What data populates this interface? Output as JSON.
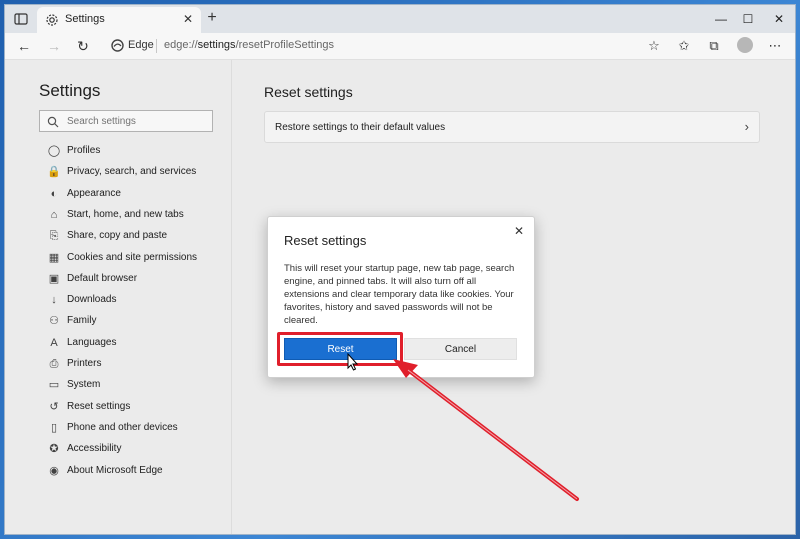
{
  "browser": {
    "tab_title": "Settings",
    "new_tab_glyph": "+",
    "close_tab_glyph": "✕",
    "edge_label": "Edge",
    "url_prefix": "edge://",
    "url_host": "settings",
    "url_path": "/resetProfileSettings",
    "window_controls": {
      "minimize": "—",
      "maximize": "☐",
      "close": "✕"
    },
    "icons": [
      "tab-actions-icon",
      "gear-icon",
      "back-icon",
      "forward-icon",
      "refresh-icon",
      "edge-logo-icon",
      "add-favorite-icon",
      "favorites-icon",
      "collections-icon",
      "profile-avatar",
      "more-icon"
    ]
  },
  "sidebar": {
    "title": "Settings",
    "search_placeholder": "Search settings",
    "items": [
      {
        "label": "Profiles",
        "icon": "profile-icon"
      },
      {
        "label": "Privacy, search, and services",
        "icon": "lock-icon"
      },
      {
        "label": "Appearance",
        "icon": "appearance-icon"
      },
      {
        "label": "Start, home, and new tabs",
        "icon": "home-icon"
      },
      {
        "label": "Share, copy and paste",
        "icon": "share-icon"
      },
      {
        "label": "Cookies and site permissions",
        "icon": "cookies-icon"
      },
      {
        "label": "Default browser",
        "icon": "browser-icon"
      },
      {
        "label": "Downloads",
        "icon": "download-icon"
      },
      {
        "label": "Family",
        "icon": "family-icon"
      },
      {
        "label": "Languages",
        "icon": "language-icon"
      },
      {
        "label": "Printers",
        "icon": "printer-icon"
      },
      {
        "label": "System",
        "icon": "system-icon"
      },
      {
        "label": "Reset settings",
        "icon": "reset-icon"
      },
      {
        "label": "Phone and other devices",
        "icon": "phone-icon"
      },
      {
        "label": "Accessibility",
        "icon": "accessibility-icon"
      },
      {
        "label": "About Microsoft Edge",
        "icon": "edge-icon"
      }
    ]
  },
  "main": {
    "title": "Reset settings",
    "card_label": "Restore settings to their default values"
  },
  "dialog": {
    "title": "Reset settings",
    "body": "This will reset your startup page, new tab page, search engine, and pinned tabs. It will also turn off all extensions and clear temporary data like cookies. Your favorites, history and saved passwords will not be cleared.",
    "reset_label": "Reset",
    "cancel_label": "Cancel",
    "close_glyph": "✕"
  },
  "colors": {
    "accent": "#1a6fd1",
    "highlight": "#e01f2b"
  }
}
